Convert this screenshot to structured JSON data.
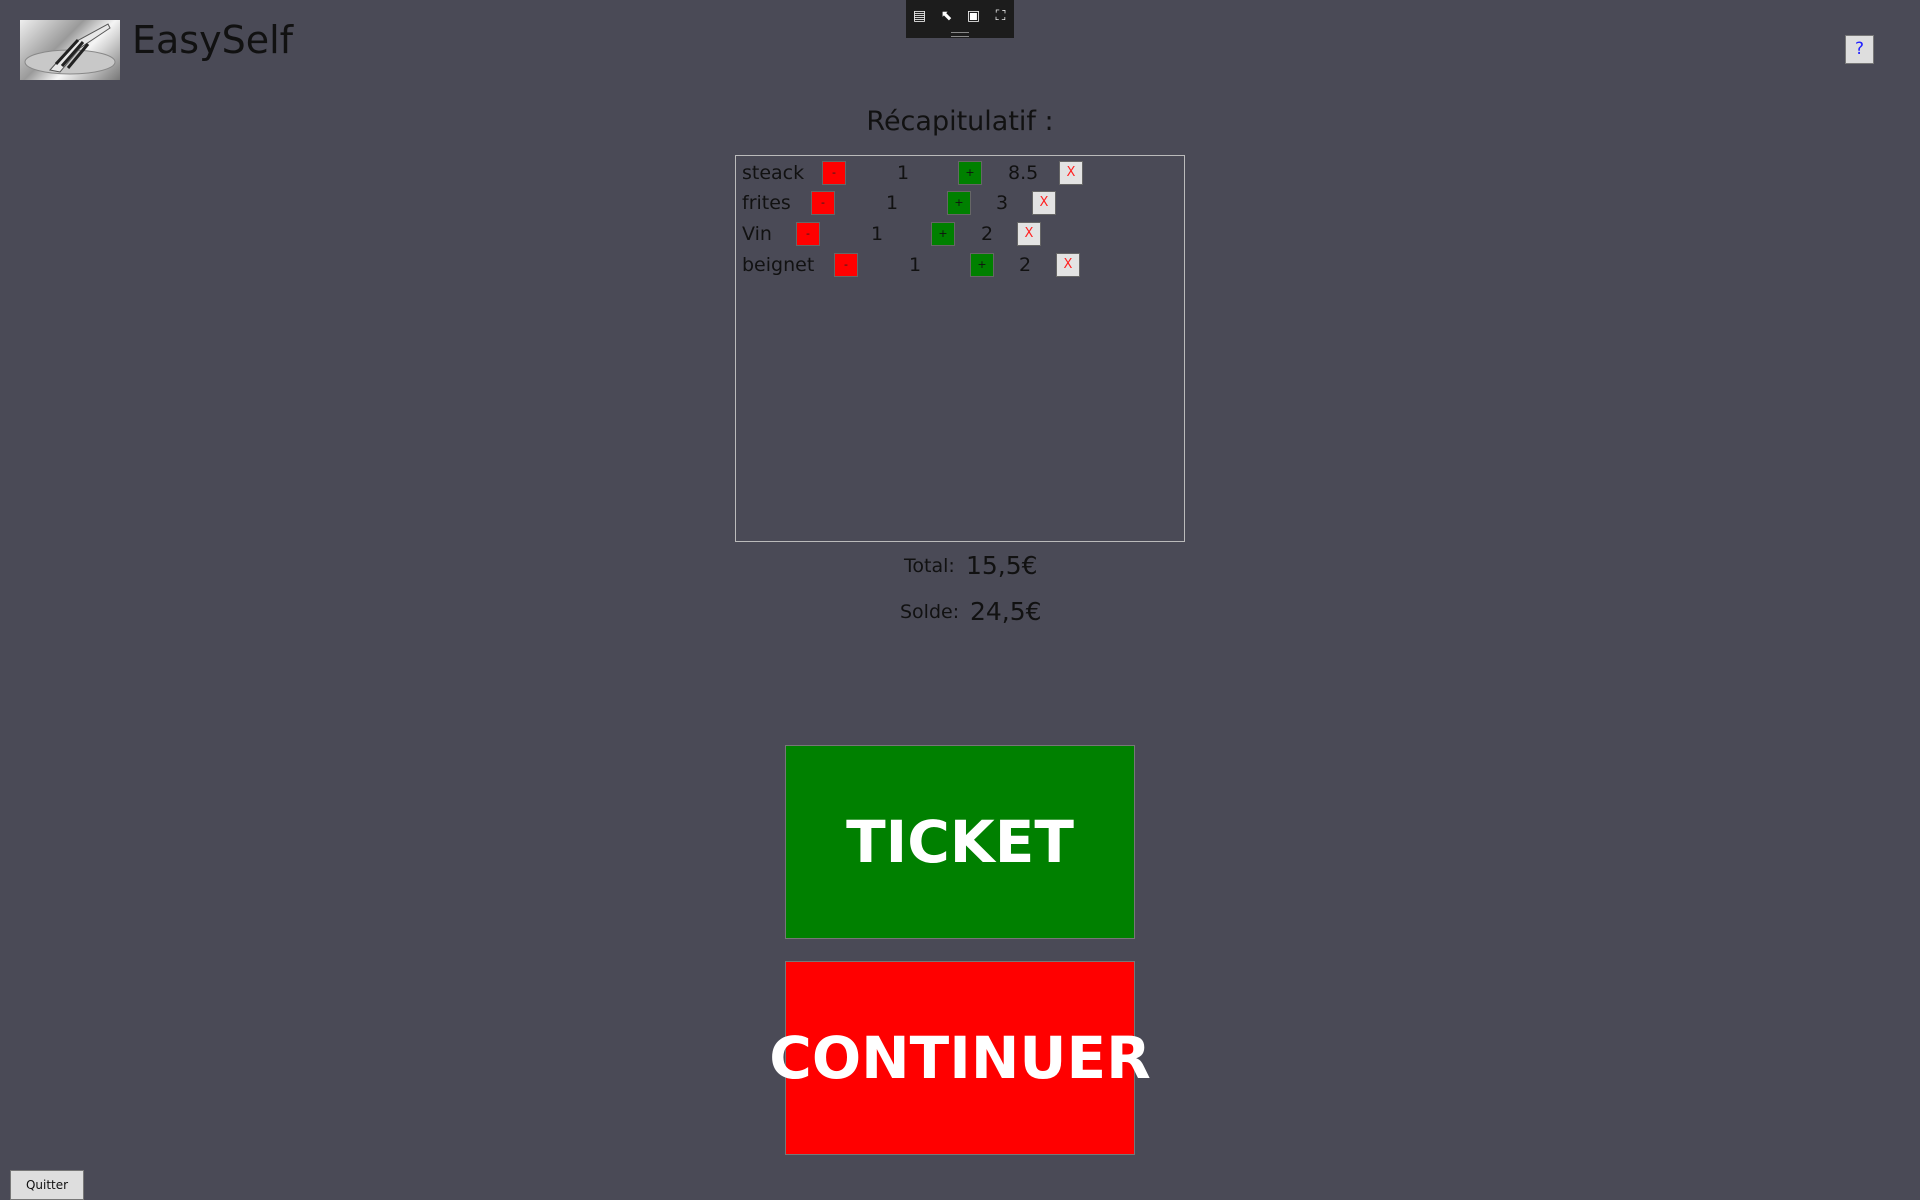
{
  "header": {
    "title": "EasySelf",
    "help_label": "?"
  },
  "toolbar": {
    "icons": [
      "inspect-tree-icon",
      "select-element-icon",
      "display-layout-icon",
      "track-focus-icon"
    ]
  },
  "recap": {
    "title": "Récapitulatif :"
  },
  "items": [
    {
      "name": "steack",
      "minus": "-",
      "qty": "1",
      "plus": "+",
      "price": "8.5",
      "remove": "X"
    },
    {
      "name": "frites",
      "minus": "-",
      "qty": "1",
      "plus": "+",
      "price": "3",
      "remove": "X"
    },
    {
      "name": "Vin",
      "minus": "-",
      "qty": "1",
      "plus": "+",
      "price": "2",
      "remove": "X"
    },
    {
      "name": "beignet",
      "minus": "-",
      "qty": "1",
      "plus": "+",
      "price": "2",
      "remove": "X"
    }
  ],
  "summary": {
    "total_label": "Total:",
    "total_value": "15,5€",
    "solde_label": "Solde:",
    "solde_value": "24,5€"
  },
  "actions": {
    "ticket": "TICKET",
    "continuer": "CONTINUER",
    "quit": "Quitter"
  },
  "colors": {
    "background": "#4a4a56",
    "ticket": "#008000",
    "continuer": "#ff0000"
  }
}
